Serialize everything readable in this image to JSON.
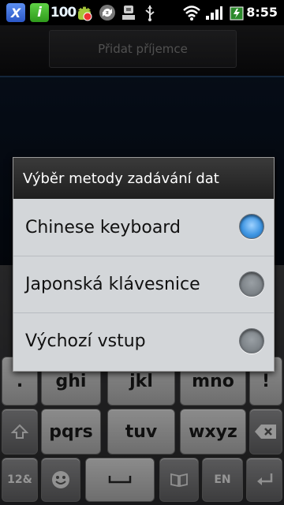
{
  "status_bar": {
    "time": "8:55",
    "app_badge": "100"
  },
  "app": {
    "add_recipient_label": "Přidat příjemce"
  },
  "dialog": {
    "title": "Výběr metody zadávání dat",
    "options": [
      {
        "label": "Chinese keyboard",
        "selected": true
      },
      {
        "label": "Japonská klávesnice",
        "selected": false
      },
      {
        "label": "Výchozí vstup",
        "selected": false
      }
    ]
  },
  "keyboard": {
    "row_top": [
      ".",
      "ghi",
      "jkl",
      "mno",
      "!"
    ],
    "row_mid": [
      "pqrs",
      "tuv",
      "wxyz"
    ],
    "bottom": {
      "num_label": "12&",
      "lang_label": "EN"
    }
  },
  "colors": {
    "selected_radio": "#3e95e2",
    "dialog_bg": "#d3d6d9",
    "dialog_title_bg": "#2a2a2a"
  }
}
